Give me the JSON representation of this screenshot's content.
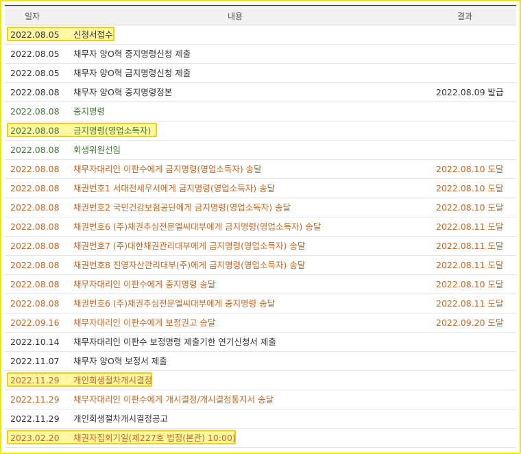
{
  "header": {
    "date": "일자",
    "content": "내용",
    "result": "결과"
  },
  "rows": [
    {
      "date": "2022.08.05",
      "content": "신청서접수",
      "result": ""
    },
    {
      "date": "2022.08.05",
      "content": "채무자 양O혁 중지명령신청 제출",
      "result": ""
    },
    {
      "date": "2022.08.05",
      "content": "채무자 양O혁 금지명령신청 제출",
      "result": ""
    },
    {
      "date": "2022.08.08",
      "content": "채무자 양O혁 중지명령정본",
      "result": "2022.08.09 발급"
    },
    {
      "date": "2022.08.08",
      "content": "중지명령",
      "result": ""
    },
    {
      "date": "2022.08.08",
      "content": "금지명령(영업소득자)",
      "result": ""
    },
    {
      "date": "2022.08.08",
      "content": "회생위원선임",
      "result": ""
    },
    {
      "date": "2022.08.08",
      "content": "채무자대리인 이판수에게 금지명령(영업소득자) 송달",
      "result": "2022.08.10 도달"
    },
    {
      "date": "2022.08.08",
      "content": "채권번호1 서대전세무서에게 금지명령(영업소득자) 송달",
      "result": "2022.08.10 도달"
    },
    {
      "date": "2022.08.08",
      "content": "채권번호2 국민건강보험공단에게 금지명령(영업소득자) 송달",
      "result": "2022.08.10 도달"
    },
    {
      "date": "2022.08.08",
      "content": "채권번호6 (주)채권추심전문엘씨대부에게 금지명령(영업소득자) 송달",
      "result": "2022.08.11 도달"
    },
    {
      "date": "2022.08.08",
      "content": "채권번호7 (주)대한채권관리대부에게 금지명령(영업소득자) 송달",
      "result": "2022.08.11 도달"
    },
    {
      "date": "2022.08.08",
      "content": "채권번호8 진영자산관리대부(주)에게 금지명령(영업소득자) 송달",
      "result": "2022.08.11 도달"
    },
    {
      "date": "2022.08.08",
      "content": "채무자대리인 이판수에게 중지명령 송달",
      "result": "2022.08.10 도달"
    },
    {
      "date": "2022.08.08",
      "content": "채권번호6 (주)채권추심전문엘씨대부에게 중지명령 송달",
      "result": "2022.08.11 도달"
    },
    {
      "date": "2022.09.16",
      "content": "채무자대리인 이판수에게 보정권고 송달",
      "result": "2022.09.20 도달"
    },
    {
      "date": "2022.10.14",
      "content": "채무자대리인 이판수 보정명령 제출기한 연기신청서 제출",
      "result": ""
    },
    {
      "date": "2022.11.07",
      "content": "채무자 양O혁 보정서 제출",
      "result": ""
    },
    {
      "date": "2022.11.29",
      "content": "개인회생절차개시결정",
      "result": ""
    },
    {
      "date": "2022.11.29",
      "content": "채무자대리인 이판수에게 개시결정/개시결정통지서 송달",
      "result": ""
    },
    {
      "date": "2022.11.29",
      "content": "개인회생절차개시결정공고",
      "result": ""
    },
    {
      "date": "2023.02.20",
      "content": "채권자집회기일(제227호 법정(본관) 10:00)",
      "result": ""
    }
  ],
  "colors": {
    "black": "#333333",
    "orange": "#c8661f",
    "green": "#3d7a2f",
    "highlight_fill": "#fff7a3",
    "highlight_border": "#f0d000"
  }
}
